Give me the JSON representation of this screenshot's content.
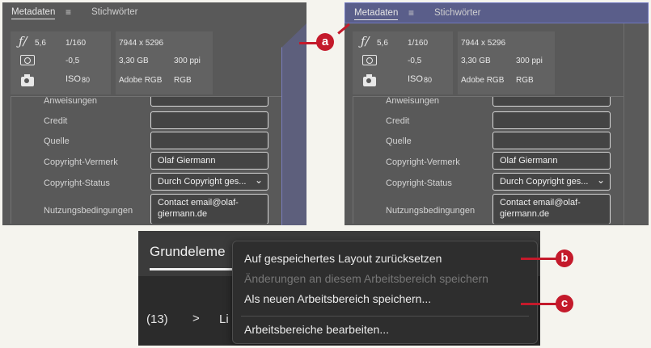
{
  "metadata_panel": {
    "tab_metadata": "Metadaten",
    "menu_icon": "menu-icon",
    "tab_keywords": "Stichwörter",
    "camera": {
      "aperture": "5,6",
      "shutter": "1/160",
      "exposure": "-0,5",
      "iso_label": "ISO",
      "iso_value": "80"
    },
    "file": {
      "dimensions": "7944 x 5296",
      "size": "3,30 GB",
      "resolution": "300 ppi",
      "profile": "Adobe RGB",
      "color_mode": "RGB"
    },
    "fields": [
      {
        "label": "Anweisungen",
        "value": ""
      },
      {
        "label": "Credit",
        "value": ""
      },
      {
        "label": "Quelle",
        "value": ""
      },
      {
        "label": "Copyright-Vermerk",
        "value": "Olaf Giermann"
      },
      {
        "label": "Copyright-Status",
        "value": "Durch Copyright ges..."
      },
      {
        "label": "Nutzungsbedingungen",
        "value": "Contact email@olaf-giermann.de"
      }
    ]
  },
  "callouts": {
    "a": "a",
    "b": "b",
    "c": "c"
  },
  "workspace": {
    "title": "Grundeleme",
    "count": "(13)",
    "arrow": ">",
    "truncated": "Li",
    "menu": {
      "reset": "Auf gespeichertes Layout zurücksetzen",
      "save_changes": "Änderungen an diesem Arbeitsbereich speichern",
      "save_new": "Als neuen Arbeitsbereich speichern...",
      "edit": "Arbeitsbereiche bearbeiten..."
    }
  },
  "colors": {
    "panel_bg": "#595959",
    "highlight": "#5a5e8a",
    "callout": "#c41a2b",
    "menu_bg": "#2e2e2e"
  }
}
